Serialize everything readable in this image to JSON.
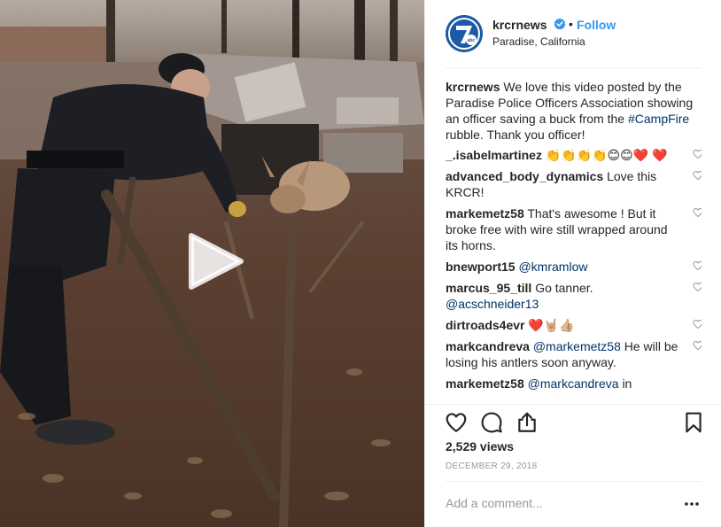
{
  "header": {
    "username": "krcrnews",
    "dot": "•",
    "follow_label": "Follow",
    "location": "Paradise, California",
    "verified_icon": "verified-badge-icon",
    "avatar_icon": "krcr-7-abc-logo"
  },
  "caption": {
    "username": "krcrnews",
    "text_before": "We love this video posted by the Paradise Police Officers Association showing an officer saving a buck from the",
    "hashtag": "#CampFire",
    "text_after": "rubble. Thank you officer!"
  },
  "comments": [
    {
      "username": "_.isabelmartinez",
      "emoji_label": "👏👏👏👏😊😊❤️ ❤️"
    },
    {
      "username": "advanced_body_dynamics",
      "text": "Love this KRCR!"
    },
    {
      "username": "markemetz58",
      "text": "That's awesome ! But it broke free with wire still wrapped around its horns."
    },
    {
      "username": "bnewport15",
      "mention": "@kmramlow"
    },
    {
      "username": "marcus_95_till",
      "text": "Go tanner.",
      "mention": "@acschneider13"
    },
    {
      "username": "dirtroads4evr",
      "emoji_label": "❤️🤘🏼👍🏼"
    },
    {
      "username": "markcandreva",
      "mention": "@markemetz58",
      "text": "He will be losing his antlers soon anyway."
    },
    {
      "username": "markemetz58",
      "mention": "@markcandreva",
      "text": "in"
    }
  ],
  "actions": {
    "like_icon": "heart-outline-icon",
    "comment_icon": "speech-bubble-icon",
    "share_icon": "share-upload-icon",
    "save_icon": "bookmark-icon"
  },
  "views": "2,529 views",
  "date": "DECEMBER 29, 2018",
  "comment_input": {
    "placeholder": "Add a comment...",
    "value": ""
  },
  "more_icon": "more-options-icon",
  "media": {
    "type": "video",
    "play_icon": "play-icon"
  },
  "colors": {
    "link": "#3897f0",
    "mention": "#003569",
    "text": "#262626",
    "muted": "#999999",
    "divider": "#efefef",
    "heart_red": "#e0142a"
  }
}
